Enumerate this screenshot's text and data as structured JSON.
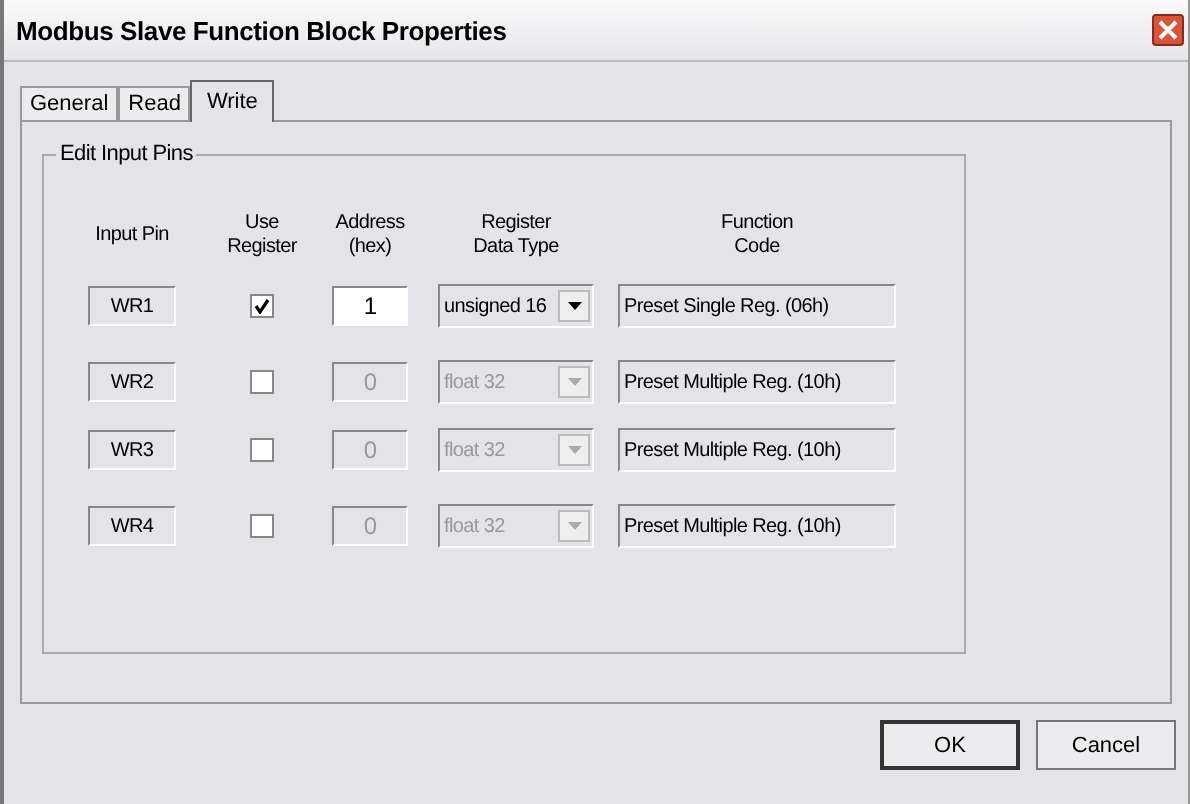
{
  "window": {
    "title": "Modbus Slave Function Block Properties"
  },
  "tabs": [
    {
      "label": "General",
      "selected": false
    },
    {
      "label": "Read",
      "selected": false
    },
    {
      "label": "Write",
      "selected": true
    }
  ],
  "group": {
    "title": "Edit Input Pins",
    "headers": [
      "Input Pin",
      "Use Register",
      "Address (hex)",
      "Register Data Type",
      "Function Code"
    ]
  },
  "rows": [
    {
      "pin": "WR1",
      "use_register": true,
      "address": "1",
      "data_type": "unsigned 16",
      "function_code": "Preset Single Reg. (06h)"
    },
    {
      "pin": "WR2",
      "use_register": false,
      "address": "0",
      "data_type": "float 32",
      "function_code": "Preset Multiple Reg. (10h)"
    },
    {
      "pin": "WR3",
      "use_register": false,
      "address": "0",
      "data_type": "float 32",
      "function_code": "Preset Multiple Reg. (10h)"
    },
    {
      "pin": "WR4",
      "use_register": false,
      "address": "0",
      "data_type": "float 32",
      "function_code": "Preset Multiple Reg. (10h)"
    }
  ],
  "buttons": [
    "OK",
    "Cancel"
  ]
}
